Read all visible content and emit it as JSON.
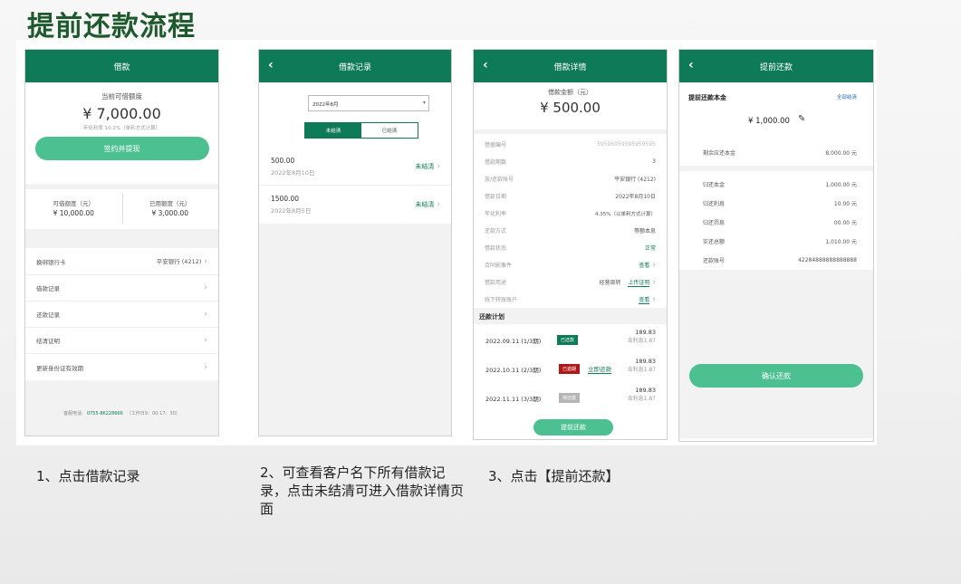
{
  "title": "提前还款流程",
  "captions": {
    "c1": "1、点击借款记录",
    "c2": "2、可查看客户名下所有借款记录，点击未结清可进入借款详情页面",
    "c3": "3、点击【提前还款】"
  },
  "colors": {
    "header_green": "#0f7a57",
    "button_green": "#4cc090",
    "title_green": "#1f5a2e"
  },
  "screen1": {
    "header": "借款",
    "available_label": "当前可借额度",
    "available_amount": "¥ 7,000.00",
    "rate_note": "年化利率 10.2%（单利方式计算）",
    "sign_button": "签约并提现",
    "limit_label": "可借额度（元）",
    "limit_value": "¥ 10,000.00",
    "used_label": "已用额度（元）",
    "used_value": "¥ 3,000.00",
    "menu": [
      {
        "label": "换绑银行卡",
        "value": "平安银行 (4212)"
      },
      {
        "label": "借款记录",
        "value": ""
      },
      {
        "label": "还款记录",
        "value": ""
      },
      {
        "label": "结清证明",
        "value": ""
      },
      {
        "label": "更新身份证有效期",
        "value": ""
      }
    ],
    "service_label": "客服电话:",
    "service_phone": "0755-86228666",
    "service_hours": "（工作日9：00-17：30）"
  },
  "screen2": {
    "header": "借款记录",
    "year_select": "2022年8月",
    "tab_unsettled": "未结清",
    "tab_settled": "已结清",
    "records": [
      {
        "amount": "500.00",
        "date": "2022年8月10日",
        "status": "未结清"
      },
      {
        "amount": "1500.00",
        "date": "2022年8月5日",
        "status": "未结清"
      }
    ]
  },
  "screen3": {
    "header": "借款详情",
    "amount_label": "借款金额（元）",
    "amount": "¥ 500.00",
    "details": [
      {
        "label": "借据编号",
        "value": "59595959595959595",
        "style": "light"
      },
      {
        "label": "借款期数",
        "value": "3",
        "style": "normal"
      },
      {
        "label": "放/还款账号",
        "value": "平安银行 (4212)",
        "style": "normal"
      },
      {
        "label": "借款日期",
        "value": "2022年8月10日",
        "style": "normal"
      },
      {
        "label": "年化利率",
        "value": "4.35%（以单利方式计算）",
        "style": "normal"
      },
      {
        "label": "还款方式",
        "value": "等额本息",
        "style": "normal"
      },
      {
        "label": "借款状态",
        "value": "正常",
        "style": "green"
      },
      {
        "label": "合同影像件",
        "value": "查看",
        "style": "link"
      },
      {
        "label": "借款用途",
        "value": "经营周转",
        "extra": "上传证明",
        "style": "normal"
      },
      {
        "label": "线下转账账户",
        "value": "查看",
        "style": "link"
      }
    ],
    "plan_title": "还款计划",
    "plan": [
      {
        "period": "2022.09.11 (1/3期)",
        "tag": "已还款",
        "tag_color": "#0f7a57",
        "action": "",
        "amount": "189.83",
        "interest": "含利息1.87"
      },
      {
        "period": "2022.10.11 (2/3期)",
        "tag": "已逾期",
        "tag_color": "#b01818",
        "action": "立即还款",
        "amount": "189.83",
        "interest": "含利息1.87"
      },
      {
        "period": "2022.11.11 (3/3期)",
        "tag": "待还款",
        "tag_color": "#b5b5b5",
        "action": "",
        "amount": "189.83",
        "interest": "含利息1.87"
      }
    ],
    "prepay_button": "提前还款"
  },
  "screen4": {
    "header": "提前还款",
    "principal_title": "提前还款本金",
    "full_settle": "全部结清",
    "input_amount": "¥ 1,000.00",
    "remaining_label": "剩余应还本金",
    "remaining_value": "8,000.00 元",
    "breakdown": [
      {
        "label": "归还本金",
        "value": "1,000.00 元"
      },
      {
        "label": "归还利息",
        "value": "10.00 元"
      },
      {
        "label": "归还罚息",
        "value": "00.00 元"
      },
      {
        "label": "实还总额",
        "value": "1,010.00 元"
      },
      {
        "label": "还款账号",
        "value": "42284888888888888"
      }
    ],
    "confirm_button": "确认还款"
  }
}
